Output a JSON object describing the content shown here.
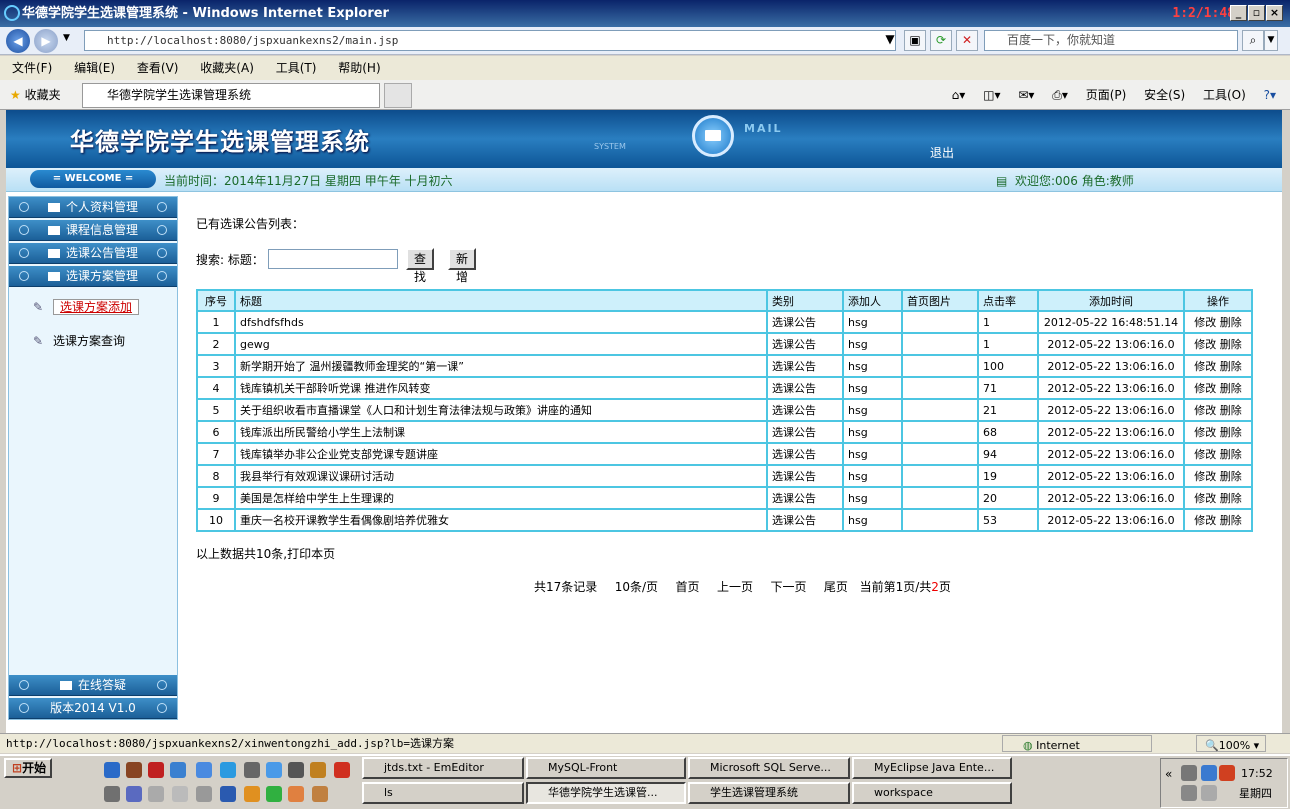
{
  "window": {
    "title": "华德学院学生选课管理系统 - Windows Internet Explorer",
    "timer": "1:2/1:48"
  },
  "addressbar": {
    "url": "http://localhost:8080/jspxuankexns2/main.jsp",
    "search_placeholder": "百度一下，你就知道"
  },
  "menubar": [
    "文件(F)",
    "编辑(E)",
    "查看(V)",
    "收藏夹(A)",
    "工具(T)",
    "帮助(H)"
  ],
  "favbar": {
    "favorites": "收藏夹",
    "tab": "华德学院学生选课管理系统",
    "cmds": [
      "页面(P)",
      "安全(S)",
      "工具(O)"
    ]
  },
  "banner": {
    "title": "华德学院学生选课管理系统",
    "system": "SYSTEM",
    "mail": "MAIL",
    "logout": "退出"
  },
  "welcome": {
    "label": "= WELCOME =",
    "time": "当前时间：2014年11月27日 星期四 甲午年 十月初六",
    "user": "欢迎您:006 角色:教师"
  },
  "sidebar": {
    "menus": [
      "个人资料管理",
      "课程信息管理",
      "选课公告管理",
      "选课方案管理"
    ],
    "subitems": [
      "选课方案添加",
      "选课方案查询"
    ],
    "bottom": [
      "在线答疑",
      "版本2014 V1.0"
    ]
  },
  "content": {
    "list_title": "已有选课公告列表：",
    "search_label": "搜索: 标题：",
    "search_button": "查找",
    "add_button": "新增",
    "columns": [
      "序号",
      "标题",
      "类别",
      "添加人",
      "首页图片",
      "点击率",
      "添加时间",
      "操作"
    ],
    "rows": [
      [
        "1",
        "dfshdfsfhds",
        "选课公告",
        "hsg",
        "",
        "1",
        "2012-05-22 16:48:51.14"
      ],
      [
        "2",
        "gewg",
        "选课公告",
        "hsg",
        "",
        "1",
        "2012-05-22 13:06:16.0"
      ],
      [
        "3",
        "新学期开始了 温州援疆教师金理奖的“第一课”",
        "选课公告",
        "hsg",
        "",
        "100",
        "2012-05-22 13:06:16.0"
      ],
      [
        "4",
        "钱库镇机关干部聆听党课 推进作风转变",
        "选课公告",
        "hsg",
        "",
        "71",
        "2012-05-22 13:06:16.0"
      ],
      [
        "5",
        "关于组织收看市直播课堂《人口和计划生育法律法规与政策》讲座的通知",
        "选课公告",
        "hsg",
        "",
        "21",
        "2012-05-22 13:06:16.0"
      ],
      [
        "6",
        "钱库派出所民警给小学生上法制课",
        "选课公告",
        "hsg",
        "",
        "68",
        "2012-05-22 13:06:16.0"
      ],
      [
        "7",
        "钱库镇举办非公企业党支部党课专题讲座",
        "选课公告",
        "hsg",
        "",
        "94",
        "2012-05-22 13:06:16.0"
      ],
      [
        "8",
        "我县举行有效观课议课研讨活动",
        "选课公告",
        "hsg",
        "",
        "19",
        "2012-05-22 13:06:16.0"
      ],
      [
        "9",
        "美国是怎样给中学生上生理课的",
        "选课公告",
        "hsg",
        "",
        "20",
        "2012-05-22 13:06:16.0"
      ],
      [
        "10",
        "重庆一名校开课教学生看偶像剧培养优雅女",
        "选课公告",
        "hsg",
        "",
        "53",
        "2012-05-22 13:06:16.0"
      ]
    ],
    "op_edit": "修改",
    "op_delete": "删除",
    "total": "以上数据共10条,打印本页",
    "pager": {
      "records": "共17条记录",
      "per_page": "10条/页",
      "first": "首页",
      "prev": "上一页",
      "next": "下一页",
      "last": "尾页",
      "current_prefix": "当前第",
      "current_page": "1",
      "middle": "页/共",
      "total_pages": "2",
      "suffix": "页"
    }
  },
  "statusbar": {
    "url": "http://localhost:8080/jspxuankexns2/xinwentongzhi_add.jsp?lb=选课方案",
    "zone": "Internet",
    "zoom": "100%"
  },
  "taskbar": {
    "start": "开始",
    "tasks_row1": [
      "jtds.txt - EmEditor",
      "MySQL-Front",
      "Microsoft SQL Serve...",
      "MyEclipse Java Ente..."
    ],
    "tasks_row2": [
      "ls",
      "华德学院学生选课管...",
      "学生选课管理系统",
      "workspace"
    ],
    "clock": "17:52",
    "day": "星期四"
  }
}
